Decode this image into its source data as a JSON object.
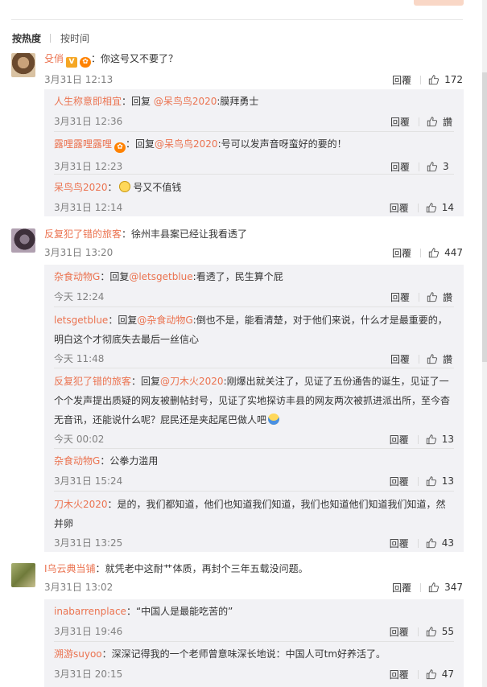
{
  "sort": {
    "hot": "按热度",
    "time": "按时间"
  },
  "labels": {
    "reply": "回覆",
    "like_word": "讚"
  },
  "colors": {
    "username": "#eb7350",
    "subbox_bg": "#f2f2f5",
    "time": "#808080"
  },
  "posts": [
    {
      "user": "殳俏",
      "sep": "：",
      "text": "你这号又不要了？",
      "time": "3月31日 12:13",
      "likes": "172",
      "replies": [
        {
          "user": "人生称意即相宜",
          "text": "：回复 ",
          "mention": "@呆鸟鸟2020",
          "text2": ":膜拜勇士",
          "time": "3月31日 12:36",
          "likes": "讚"
        },
        {
          "user": "露哩露哩露哩",
          "text": "：回复",
          "mention": "@呆鸟鸟2020",
          "text2": ":号可以发声音呀蛮好的要的！",
          "time": "3月31日 12:23",
          "likes": "3"
        },
        {
          "user": "呆鸟鸟2020",
          "text": "：",
          "text2": " 号又不值钱",
          "time": "3月31日 12:14",
          "likes": "14"
        }
      ]
    },
    {
      "user": "反复犯了错的旅客",
      "sep": "：",
      "text": "徐州丰县案已经让我看透了",
      "time": "3月31日 13:20",
      "likes": "447",
      "replies": [
        {
          "user": "杂食动物G",
          "text": "：回复",
          "mention": "@letsgetblue",
          "text2": ":看透了，民生算个屁",
          "time": "今天 12:24",
          "likes": "讚"
        },
        {
          "user": "letsgetblue",
          "text": "：回复",
          "mention": "@杂食动物G",
          "text2": ":倒也不是，能看清楚，对于他们来说，什么才是最重要的，明白这个才彻底失去最后一丝信心",
          "time": "今天 11:48",
          "likes": "讚"
        },
        {
          "user": "反复犯了错的旅客",
          "text": "：回复",
          "mention": "@刀木火2020",
          "text2": ":刚爆出就关注了，见证了五份通告的诞生，见证了一个个发声提出质疑的网友被删帖封号，见证了实地探访丰县的网友两次被抓进派出所，至今杳无音讯，还能说什么呢？屁民还是夹起尾巴做人吧",
          "time": "今天 00:02",
          "likes": "13"
        },
        {
          "user": "杂食动物G",
          "text": "：公拳力滥用",
          "time": "3月31日 15:24",
          "likes": "13"
        },
        {
          "user": "刀木火2020",
          "text": "：是的，我们都知道，他们也知道我们知道，我们也知道他们知道我们知道，然并卵",
          "time": "3月31日 13:25",
          "likes": "43"
        }
      ]
    },
    {
      "user": "I乌云典当铺",
      "sep": "：",
      "text": "就凭老中这耐艹体质，再封个三年五载没问题。",
      "time": "3月31日 13:02",
      "likes": "347",
      "replies": [
        {
          "user": "inabarrenplace",
          "text": "：“中国人是最能吃苦的”",
          "time": "3月31日 19:46",
          "likes": "55"
        },
        {
          "user": "溯游suyoo",
          "text": "：深深记得我的一个老师曾意味深长地说：中国人可tm好养活了。",
          "time": "3月31日 20:15",
          "likes": "47"
        }
      ]
    }
  ]
}
